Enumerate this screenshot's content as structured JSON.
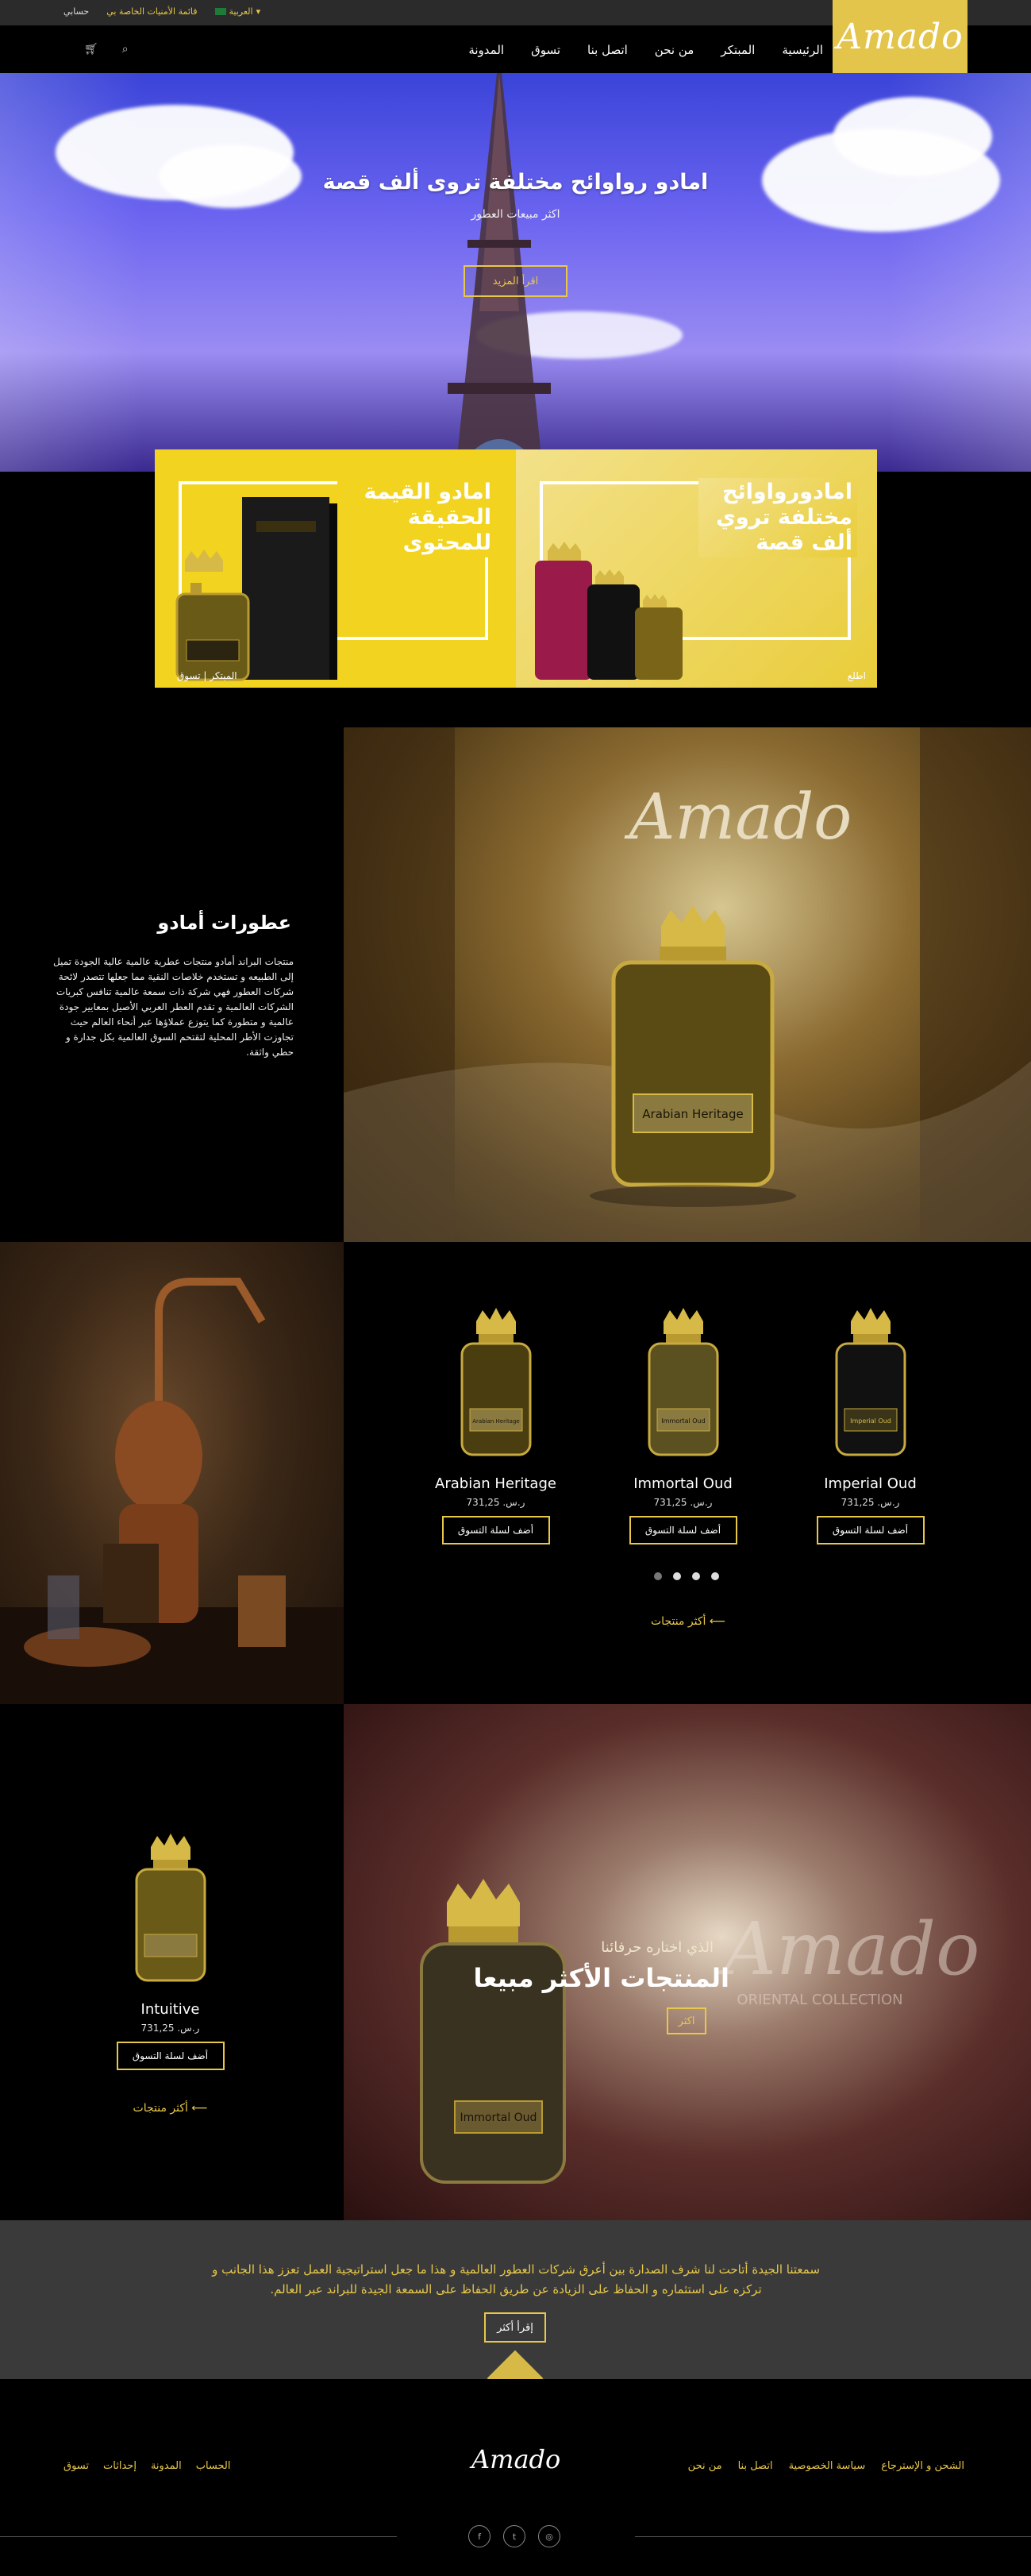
{
  "topbar": {
    "language": "العربية",
    "wishlist": "قائمة الأمنيات الخاصة بي",
    "account": "حسابي"
  },
  "nav": {
    "logo": "Amado",
    "links": [
      "الرئيسية",
      "المبتكر",
      "من نحن",
      "اتصل بنا",
      "تسوق",
      "المدونة"
    ],
    "cart_icon": "cart-icon",
    "search_icon": "search-icon"
  },
  "hero": {
    "title": "امادو رواوائح مختلفة تروى ألف قصة",
    "subtitle": "اكثر مبيعات العطور",
    "button": "اقرأ المزيد"
  },
  "promo": {
    "left_title": "امادو القيمة الحقيقة للمحتوى",
    "left_links": "المبتكر  |  تسوق",
    "right_title": "امادورواوائح مختلفة تروي ألف قصة",
    "right_links": "اطلع"
  },
  "story": {
    "title": "عطورات أمادو",
    "text": "منتجات البراند أمادو منتجات عطرية عالمية عالية الجودة تميل إلى الطبيعه و تستخدم خلاصات النقية مما جعلها تتصدر لائحة شركات العطور فهي شركة ذات سمعة عالمية تنافس كبريات الشركات العالمية و تقدم العطر العربي الأصيل بمعايير جودة عالمية و متطورة كما يتوزع عملاؤها عبر أنحاء العالم حيث تجاوزت الأطر المحلية لتقتحم السوق العالمية بكل جدارة و حطي واثقة.",
    "image_brand": "Amado",
    "bottle_label": "Arabian Heritage"
  },
  "products": {
    "items": [
      {
        "name": "Imperial Oud",
        "price": "ر.س. 731,25",
        "button": "أضف لسلة التسوق",
        "label": "Imperial Oud"
      },
      {
        "name": "Immortal Oud",
        "price": "ر.س. 731,25",
        "button": "أضف لسلة التسوق",
        "label": "Immortal Oud"
      },
      {
        "name": "Arabian Heritage",
        "price": "ر.س. 731,25",
        "button": "أضف لسلة التسوق",
        "label": "Arabian Heritage"
      }
    ],
    "more": "أكثر منتجات ⟵"
  },
  "bestseller": {
    "kicker": "الذي اختاره حرفائنا",
    "title": "المنتجات الأكثر مبيعا",
    "button": "اكثر",
    "brand": "Amado",
    "brand_sub": "ORIENTAL COLLECTION",
    "bottle_label": "Immortal Oud",
    "product": {
      "name": "Intuitive",
      "price": "ر.س. 731,25",
      "button": "أضف لسلة التسوق"
    },
    "more": "أكثر منتجات ⟵"
  },
  "quote": {
    "text": "سمعتنا الجيدة أتاحت لنا شرف الصدارة بين أعرق شركات العطور العالمية و هذا ما جعل استراتيجية العمل تعزز هذا الجانب و تركزه على استثماره و الحفاظ على الزيادة عن طريق الحفاظ على السمعة الجيدة للبراند عبر العالم.",
    "button": "إقرأ أكثر"
  },
  "footer": {
    "logo": "Amado",
    "right_links": [
      "الشحن و الإسترجاع",
      "سياسة الخصوصية",
      "اتصل بنا",
      "من نحن"
    ],
    "left_links": [
      "الحساب",
      "المدونة",
      "إحداثات",
      "تسوق"
    ],
    "social": [
      "f",
      "t",
      "◎"
    ]
  },
  "colors": {
    "accent": "#e8c84a",
    "logo_bg": "#e4c54b",
    "quote_bg": "#3a3a3a"
  }
}
